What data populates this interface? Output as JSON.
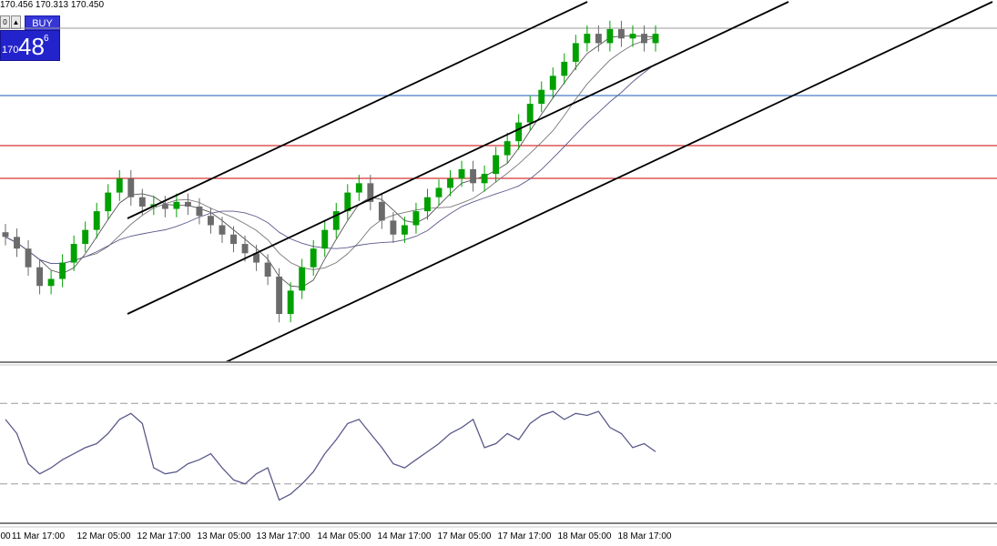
{
  "header": {
    "ohlc_text": "170.456 170.313 170.450",
    "mini_button_left": "0",
    "mini_button_right": "▲"
  },
  "trade_panel": {
    "buy_label": "BUY",
    "price_small": "170",
    "price_big": "48",
    "price_sup": "6",
    "colors": {
      "panel": "#2323cc",
      "text": "#ffffff"
    }
  },
  "chart_data": [
    {
      "type": "candlestick",
      "title": "",
      "series": [
        {
          "name": "",
          "kind": "candles",
          "values": [
            170.45,
            170.2,
            169.8,
            169.4,
            169.55,
            169.9,
            170.3,
            170.6,
            171.0,
            171.4,
            171.7,
            171.3,
            171.1,
            171.15,
            171.05,
            171.2,
            171.1,
            170.9,
            170.7,
            170.5,
            170.3,
            170.1,
            169.9,
            169.6,
            168.8,
            169.3,
            169.8,
            170.2,
            170.6,
            171.0,
            171.4,
            171.6,
            171.2,
            170.8,
            170.5,
            170.7,
            171.0,
            171.3,
            171.5,
            171.7,
            171.9,
            171.6,
            171.8,
            172.2,
            172.5,
            172.9,
            173.3,
            173.6,
            173.9,
            174.2,
            174.6,
            174.8,
            174.6,
            174.9,
            174.7,
            174.8,
            174.6,
            174.8
          ]
        }
      ],
      "overlays": {
        "moving_averages": 3,
        "channel_lines": 4,
        "horizontal_lines": [
          {
            "name": "",
            "color": "#1a5fb4"
          },
          {
            "name": "",
            "color": "#cc0000"
          },
          {
            "name": "",
            "color": "#cc0000"
          }
        ]
      },
      "x_tick_labels": [
        "11 Mar 17:00",
        "12 Mar 05:00",
        "12 Mar 17:00",
        "13 Mar 05:00",
        "13 Mar 17:00",
        "14 Mar 05:00",
        "14 Mar 17:00",
        "17 Mar 05:00",
        "17 Mar 17:00",
        "18 Mar 05:00",
        "18 Mar 17:00"
      ],
      "first_tick_fragment": "00",
      "grid": false,
      "candle_colors": {
        "up": "#00a000",
        "down": "#6b6b6b"
      }
    },
    {
      "type": "line",
      "title": "",
      "series": [
        {
          "name": "",
          "color": "#5a5a8c",
          "values": [
            62,
            55,
            40,
            35,
            38,
            42,
            45,
            48,
            50,
            55,
            62,
            65,
            60,
            38,
            35,
            36,
            40,
            42,
            45,
            38,
            32,
            30,
            35,
            38,
            22,
            25,
            30,
            36,
            45,
            52,
            60,
            62,
            55,
            48,
            40,
            38,
            42,
            46,
            50,
            55,
            58,
            62,
            48,
            50,
            55,
            52,
            60,
            64,
            66,
            62,
            65,
            64,
            66,
            58,
            55,
            48,
            50,
            46
          ]
        }
      ],
      "levels": [
        70,
        30
      ],
      "ylim": [
        15,
        85
      ]
    }
  ]
}
